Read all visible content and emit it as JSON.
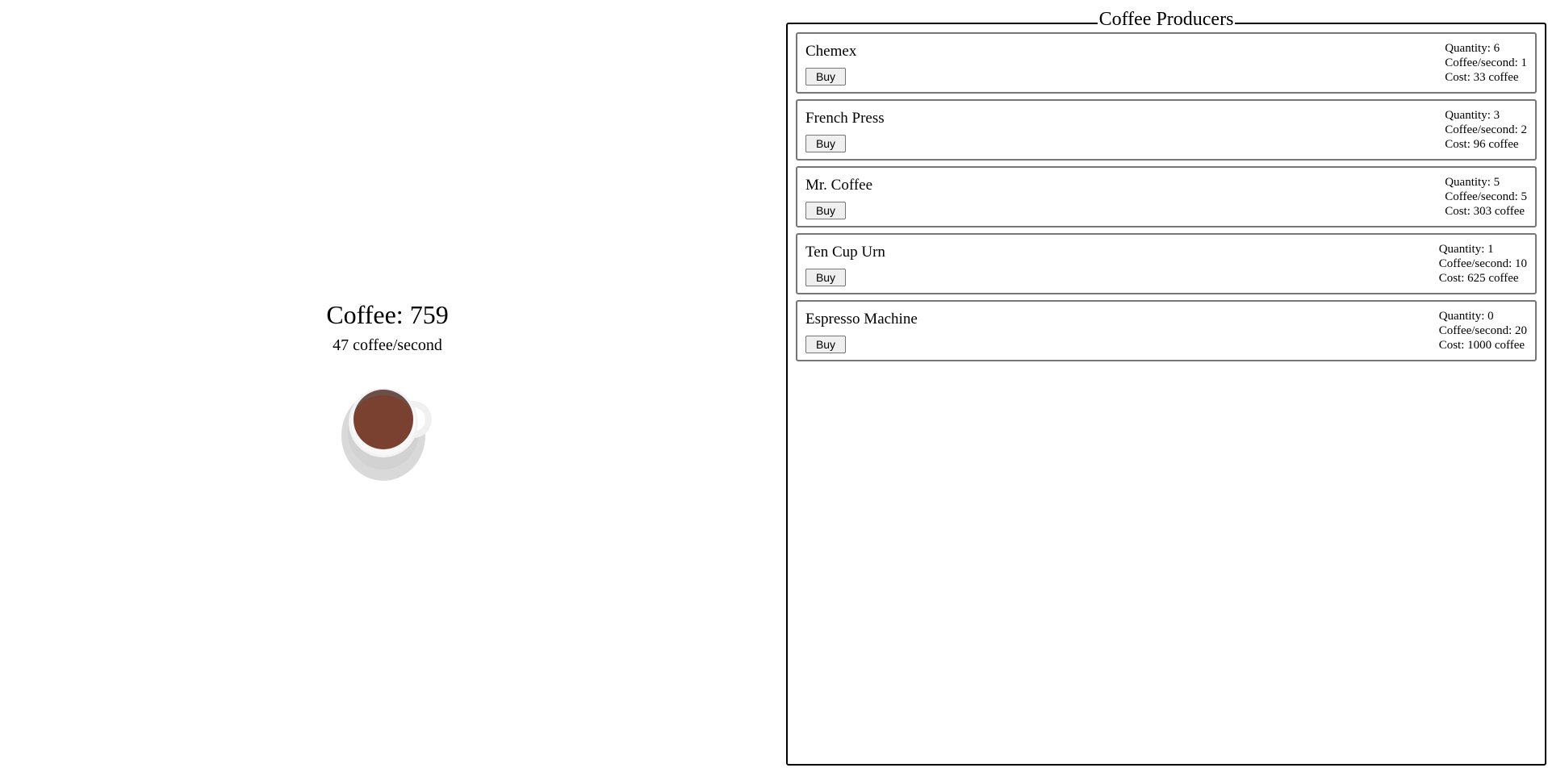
{
  "counter": {
    "coffee_label": "Coffee: 759",
    "rate_label": "47 coffee/second"
  },
  "icons": {
    "cup": "coffee-cup-icon"
  },
  "colors": {
    "coffee": "#7a4030",
    "saucer": "#d9d9d9",
    "cup": "#f5f5f5"
  },
  "panel": {
    "title": "Coffee Producers"
  },
  "producers": [
    {
      "name": "Chemex",
      "buy_label": "Buy",
      "quantity": "Quantity: 6",
      "rate": "Coffee/second: 1",
      "cost": "Cost: 33 coffee"
    },
    {
      "name": "French Press",
      "buy_label": "Buy",
      "quantity": "Quantity: 3",
      "rate": "Coffee/second: 2",
      "cost": "Cost: 96 coffee"
    },
    {
      "name": "Mr. Coffee",
      "buy_label": "Buy",
      "quantity": "Quantity: 5",
      "rate": "Coffee/second: 5",
      "cost": "Cost: 303 coffee"
    },
    {
      "name": "Ten Cup Urn",
      "buy_label": "Buy",
      "quantity": "Quantity: 1",
      "rate": "Coffee/second: 10",
      "cost": "Cost: 625 coffee"
    },
    {
      "name": "Espresso Machine",
      "buy_label": "Buy",
      "quantity": "Quantity: 0",
      "rate": "Coffee/second: 20",
      "cost": "Cost: 1000 coffee"
    }
  ]
}
